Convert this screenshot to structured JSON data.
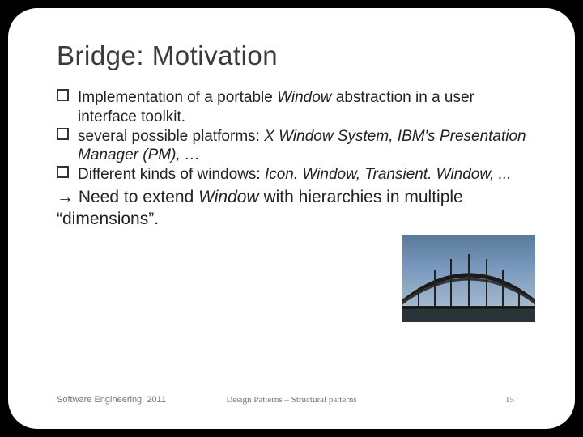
{
  "title": "Bridge: Motivation",
  "bullets": [
    {
      "text_a": "Implementation of a portable ",
      "em_a": "Window",
      "text_b": " abstraction in a user interface toolkit."
    },
    {
      "text_a": " several possible platforms: ",
      "em_a": "X Window System, IBM's Presentation Manager (PM), …",
      "text_b": ""
    },
    {
      "text_a": "Different kinds of windows: ",
      "em_a": "Icon. Window, Transient. Window, ...",
      "text_b": ""
    }
  ],
  "conclusion": {
    "arrow": "→",
    "text_a": " Need to extend ",
    "em": "Window",
    "text_b": " with hierarchies in multiple “dimensions”."
  },
  "footer": {
    "left": "Software Engineering, 2011",
    "center": "Design Patterns – Structural patterns",
    "page": "15"
  }
}
